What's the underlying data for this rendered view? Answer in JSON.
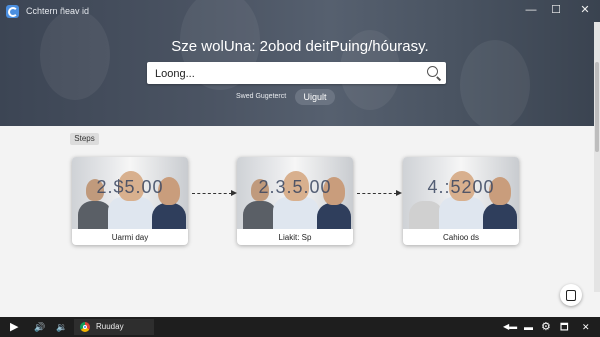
{
  "window": {
    "title": "Cchtern ñeav id",
    "controls": {
      "minimize": "—",
      "maximize": "☐",
      "close": "✕"
    }
  },
  "hero": {
    "heading": "Sze wolUna: 2obod deitPuing/hóurasy.",
    "search": {
      "value": "Loong...",
      "placeholder": "Loong..."
    },
    "filter_label": "Swed Gugeterct",
    "filter_button": "Uigult"
  },
  "steps": {
    "tag": "Steps",
    "cards": [
      {
        "overlay": "2.$5.00",
        "label": "Uarmi day"
      },
      {
        "overlay": "2.3.5.00",
        "label": "Liakit: Sp"
      },
      {
        "overlay": "4.:5200",
        "label": "Cahioo ds"
      }
    ]
  },
  "taskbar": {
    "play": "▶",
    "volume": "🔊",
    "volume2": "🔉",
    "app_label": "Ruuday",
    "tray": [
      "◀▬",
      "▬",
      "⚙",
      "🗖",
      "✕"
    ]
  },
  "colors": {
    "hero": "#4b5463",
    "accent": "#4b8fe0",
    "taskbar": "#1e1e1e"
  }
}
